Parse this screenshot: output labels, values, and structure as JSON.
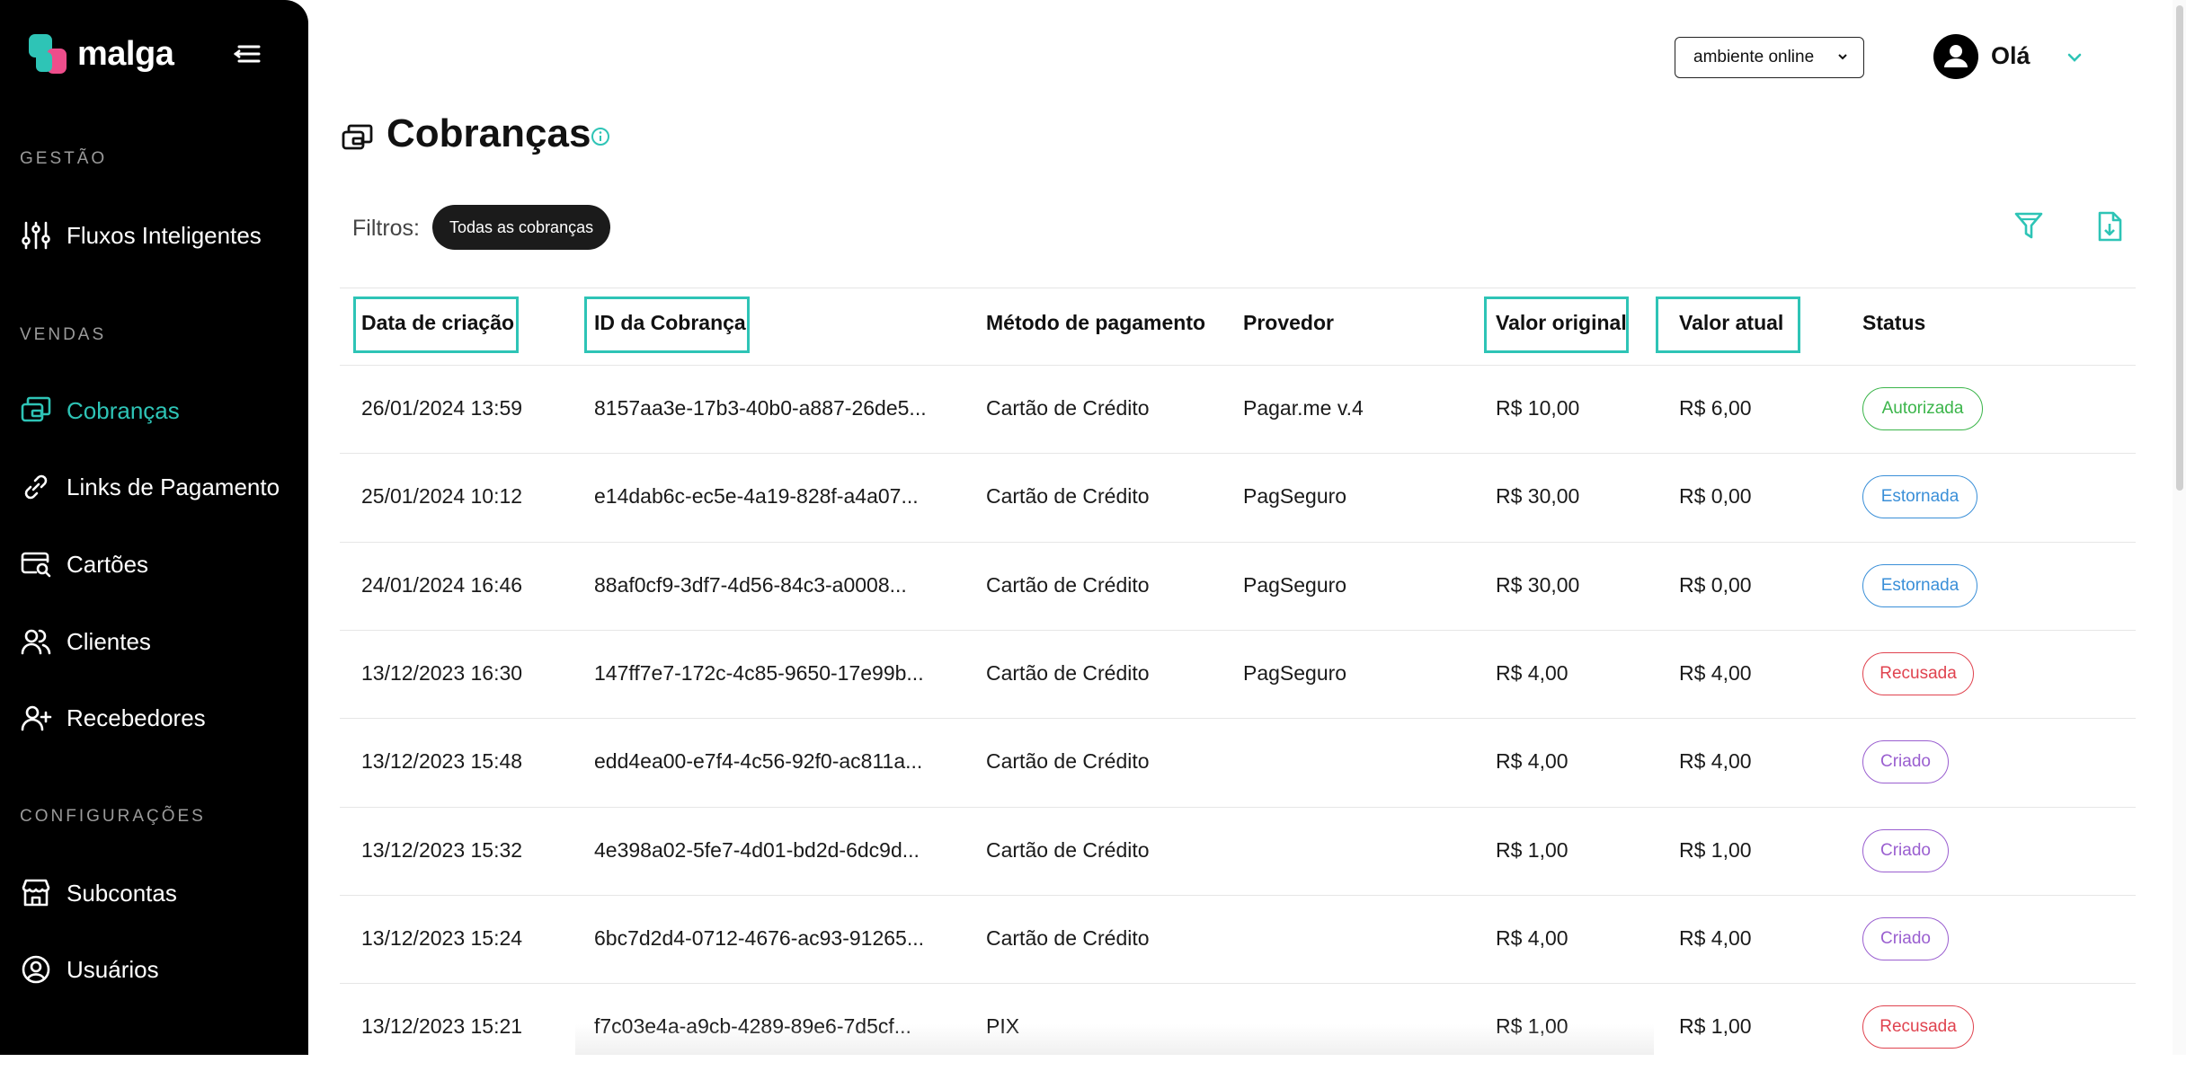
{
  "brand": {
    "name": "malga"
  },
  "sidebar": {
    "sections": [
      {
        "label": "GESTÃO"
      },
      {
        "label": "VENDAS"
      },
      {
        "label": "CONFIGURAÇÕES"
      }
    ],
    "items": [
      {
        "label": "Fluxos Inteligentes",
        "icon": "sliders-icon"
      },
      {
        "label": "Cobranças",
        "icon": "charges-icon",
        "active": true
      },
      {
        "label": "Links de Pagamento",
        "icon": "link-icon"
      },
      {
        "label": "Cartões",
        "icon": "card-search-icon"
      },
      {
        "label": "Clientes",
        "icon": "users-icon"
      },
      {
        "label": "Recebedores",
        "icon": "user-plus-icon"
      },
      {
        "label": "Subcontas",
        "icon": "store-icon"
      },
      {
        "label": "Usuários",
        "icon": "user-circle-icon"
      }
    ]
  },
  "topbar": {
    "environment": "ambiente online",
    "greeting": "Olá"
  },
  "page": {
    "title": "Cobranças",
    "filters_label": "Filtros:",
    "filter_chip": "Todas as cobranças"
  },
  "table": {
    "headers": [
      "Data de criação",
      "ID da Cobrança",
      "Método de pagamento",
      "Provedor",
      "Valor original",
      "Valor atual",
      "Status"
    ],
    "rows": [
      [
        "26/01/2024 13:59",
        "8157aa3e-17b3-40b0-a887-26de5...",
        "Cartão de Crédito",
        "Pagar.me v.4",
        "R$ 10,00",
        "R$ 6,00",
        "Autorizada"
      ],
      [
        "25/01/2024 10:12",
        "e14dab6c-ec5e-4a19-828f-a4a07...",
        "Cartão de Crédito",
        "PagSeguro",
        "R$ 30,00",
        "R$ 0,00",
        "Estornada"
      ],
      [
        "24/01/2024 16:46",
        "88af0cf9-3df7-4d56-84c3-a0008...",
        "Cartão de Crédito",
        "PagSeguro",
        "R$ 30,00",
        "R$ 0,00",
        "Estornada"
      ],
      [
        "13/12/2023 16:30",
        "147ff7e7-172c-4c85-9650-17e99b...",
        "Cartão de Crédito",
        "PagSeguro",
        "R$ 4,00",
        "R$ 4,00",
        "Recusada"
      ],
      [
        "13/12/2023 15:48",
        "edd4ea00-e7f4-4c56-92f0-ac811a...",
        "Cartão de Crédito",
        "",
        "R$ 4,00",
        "R$ 4,00",
        "Criado"
      ],
      [
        "13/12/2023 15:32",
        "4e398a02-5fe7-4d01-bd2d-6dc9d...",
        "Cartão de Crédito",
        "",
        "R$ 1,00",
        "R$ 1,00",
        "Criado"
      ],
      [
        "13/12/2023 15:24",
        "6bc7d2d4-0712-4676-ac93-91265...",
        "Cartão de Crédito",
        "",
        "R$ 4,00",
        "R$ 4,00",
        "Criado"
      ],
      [
        "13/12/2023 15:21",
        "f7c03e4a-a9cb-4289-89e6-7d5cf...",
        "PIX",
        "",
        "R$ 1,00",
        "R$ 1,00",
        "Recusada"
      ]
    ],
    "status_colors": {
      "Autorizada": "#3bb54a",
      "Estornada": "#3a8fd8",
      "Recusada": "#e0434f",
      "Criado": "#9a5fd0"
    }
  },
  "colors": {
    "accent": "#2ec4b6",
    "brand_pink": "#ee4d8b",
    "sidebar_bg": "#000000"
  }
}
